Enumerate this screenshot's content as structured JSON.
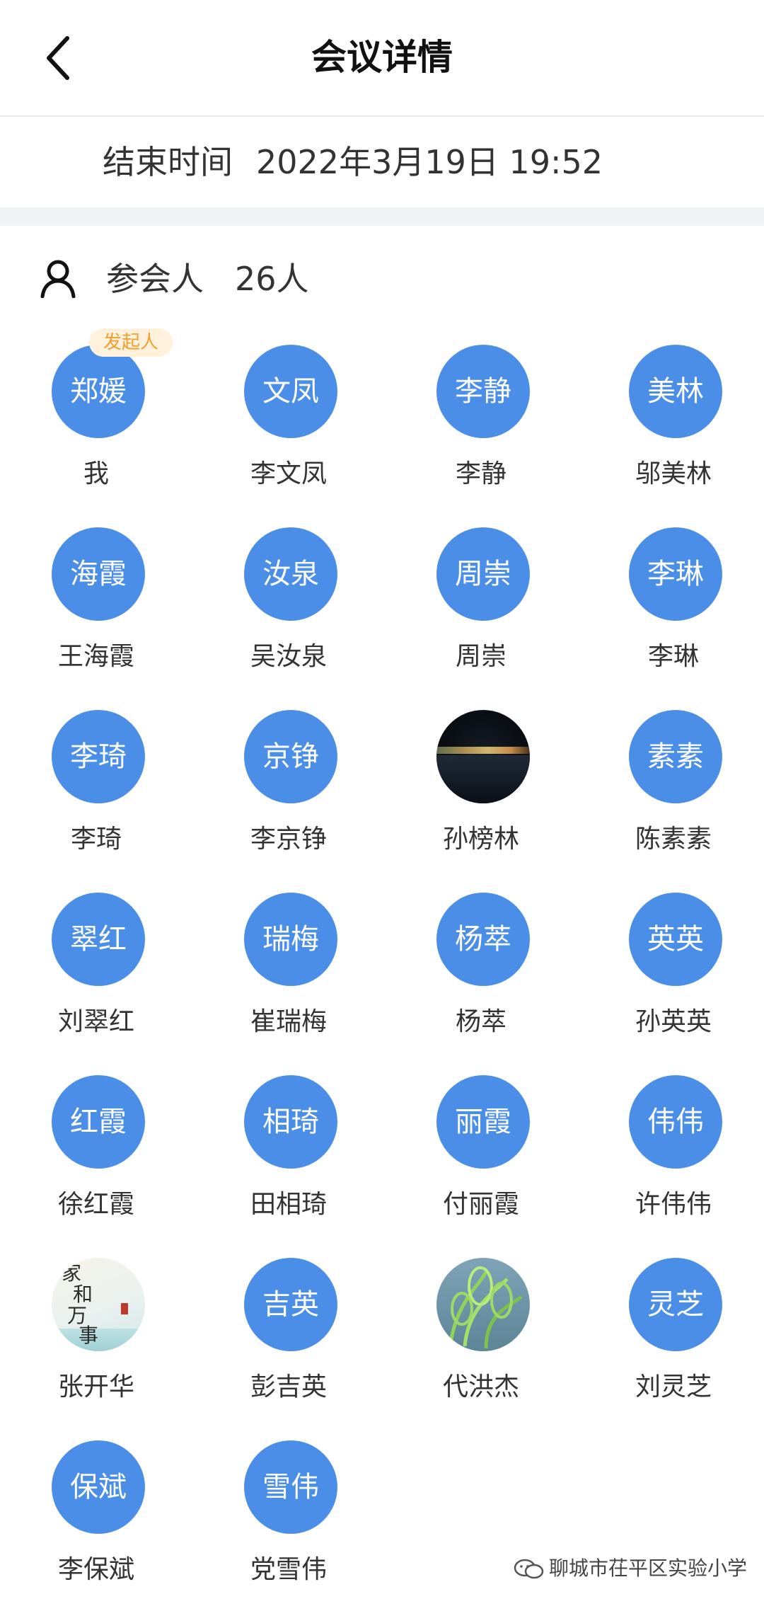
{
  "header": {
    "title": "会议详情",
    "back_icon": "chevron-left-icon"
  },
  "meeting": {
    "end_label": "结束时间",
    "end_value": "2022年3月19日 19:52"
  },
  "participants": {
    "label": "参会人",
    "count": "26人",
    "icon": "person-icon",
    "initiator_badge": "发起人"
  },
  "members": [
    {
      "avatar_text": "郑媛",
      "name": "我",
      "initiator": true
    },
    {
      "avatar_text": "文凤",
      "name": "李文凤"
    },
    {
      "avatar_text": "李静",
      "name": "李静"
    },
    {
      "avatar_text": "美林",
      "name": "邬美林"
    },
    {
      "avatar_text": "海霞",
      "name": "王海霞"
    },
    {
      "avatar_text": "汝泉",
      "name": "吴汝泉"
    },
    {
      "avatar_text": "周崇",
      "name": "周崇"
    },
    {
      "avatar_text": "李琳",
      "name": "李琳"
    },
    {
      "avatar_text": "李琦",
      "name": "李琦"
    },
    {
      "avatar_text": "京铮",
      "name": "李京铮"
    },
    {
      "avatar_text": "",
      "name": "孙榜林",
      "photo": "night-lake"
    },
    {
      "avatar_text": "素素",
      "name": "陈素素"
    },
    {
      "avatar_text": "翠红",
      "name": "刘翠红"
    },
    {
      "avatar_text": "瑞梅",
      "name": "崔瑞梅"
    },
    {
      "avatar_text": "杨萃",
      "name": "杨萃"
    },
    {
      "avatar_text": "英英",
      "name": "孙英英"
    },
    {
      "avatar_text": "红霞",
      "name": "徐红霞"
    },
    {
      "avatar_text": "相琦",
      "name": "田相琦"
    },
    {
      "avatar_text": "丽霞",
      "name": "付丽霞"
    },
    {
      "avatar_text": "伟伟",
      "name": "许伟伟"
    },
    {
      "avatar_text": "",
      "name": "张开华",
      "photo": "calligraphy-art",
      "art_text": [
        "家",
        "和",
        "万",
        "事"
      ]
    },
    {
      "avatar_text": "吉英",
      "name": "彭吉英"
    },
    {
      "avatar_text": "",
      "name": "代洪杰",
      "photo": "green-leaves"
    },
    {
      "avatar_text": "灵芝",
      "name": "刘灵芝"
    },
    {
      "avatar_text": "保斌",
      "name": "李保斌"
    },
    {
      "avatar_text": "雪伟",
      "name": "党雪伟"
    }
  ],
  "watermark": {
    "text": "聊城市茌平区实验小学",
    "icon": "wechat-icon"
  },
  "colors": {
    "avatar_bg": "#4a8ee8",
    "badge_bg": "#fff1db",
    "badge_text": "#f0a030"
  }
}
